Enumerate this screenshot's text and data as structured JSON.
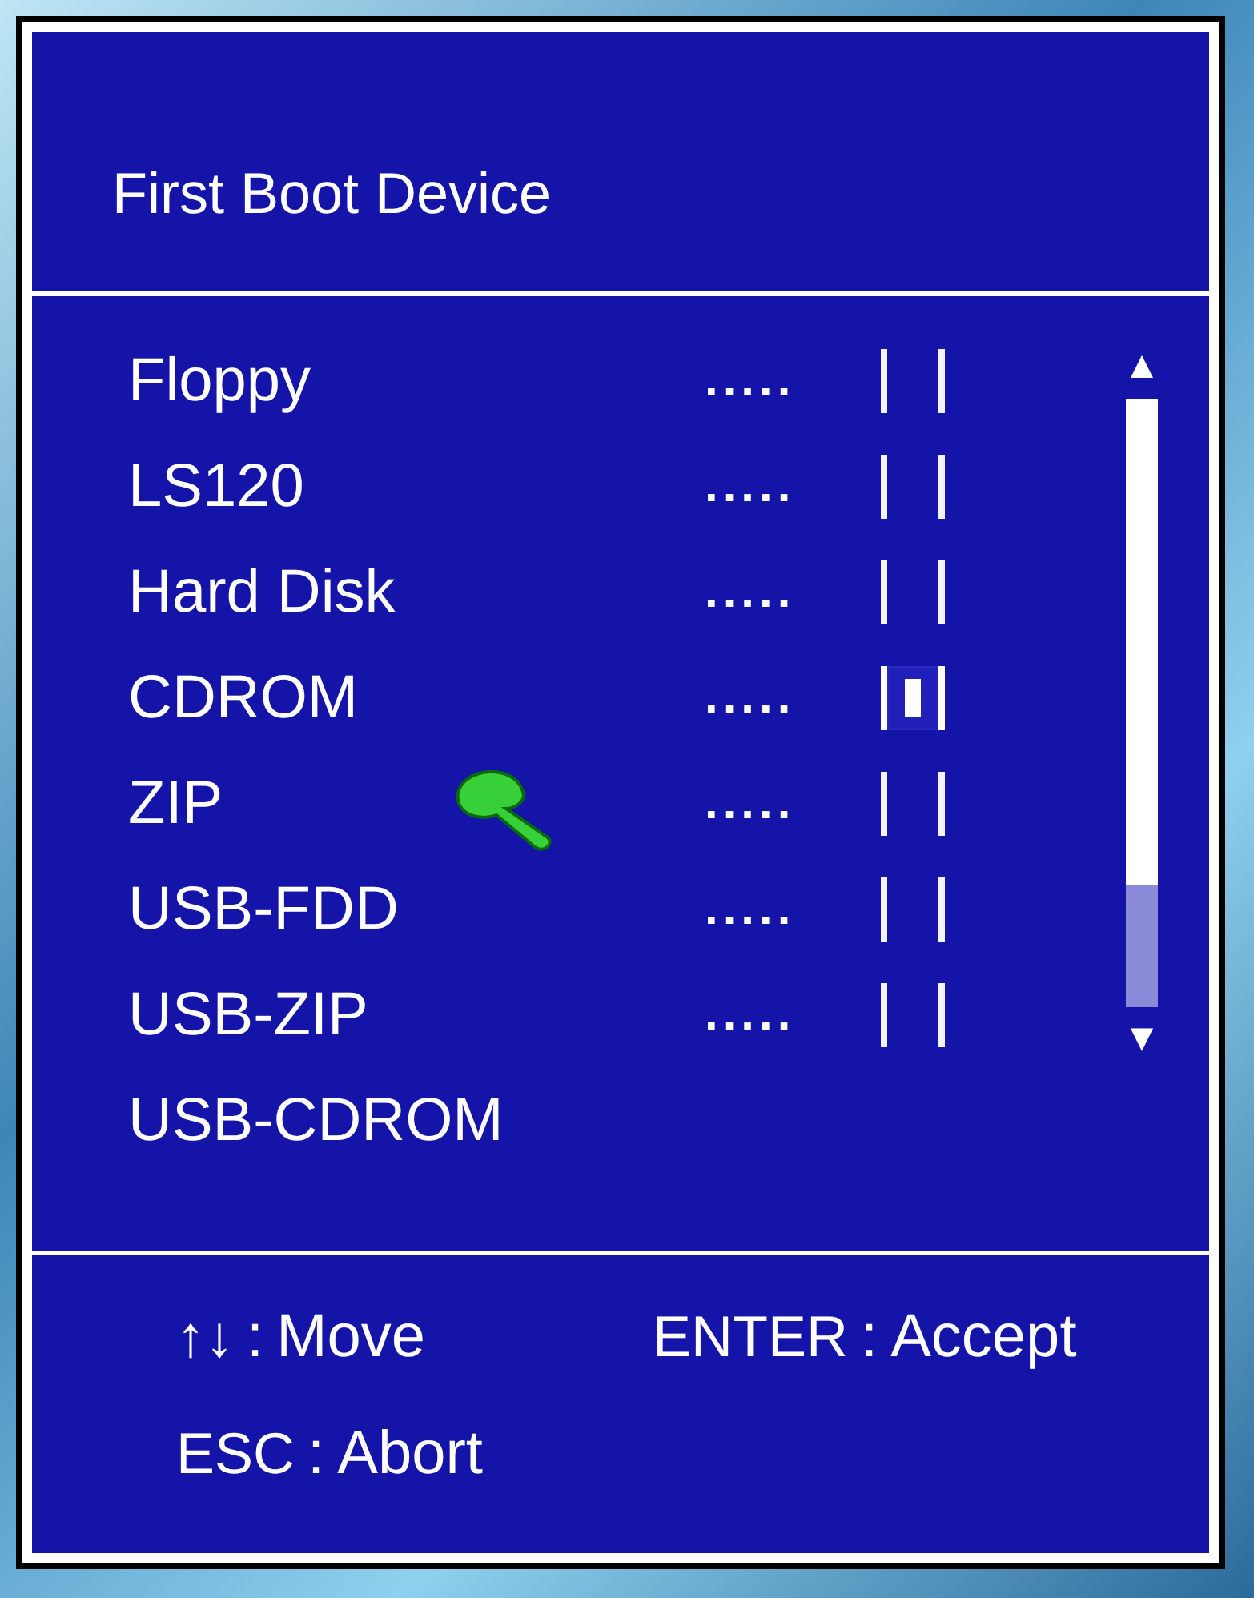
{
  "dialog": {
    "title": "First Boot Device",
    "options": [
      {
        "label": "Floppy",
        "kind": "option",
        "leader": ".....",
        "selected": false
      },
      {
        "label": "LS120",
        "kind": "option",
        "leader": ".....",
        "selected": false
      },
      {
        "label": "Hard Disk",
        "kind": "option",
        "leader": ".....",
        "selected": false
      },
      {
        "label": "CDROM",
        "kind": "option",
        "leader": ".....",
        "selected": true
      },
      {
        "label": "ZIP",
        "kind": "option",
        "leader": ".....",
        "selected": false
      },
      {
        "label": "USB-FDD",
        "kind": "option",
        "leader": ".....",
        "selected": false
      },
      {
        "label": "USB-ZIP",
        "kind": "option",
        "leader": ".....",
        "selected": false
      },
      {
        "label": "USB-CDROM",
        "kind": "plain"
      }
    ],
    "scrollbar": {
      "up": "▲",
      "down": "▼"
    },
    "hints": [
      {
        "key": "↑↓",
        "separator": ":",
        "action": "Move"
      },
      {
        "key": "ENTER",
        "separator": ":",
        "action": "Accept"
      },
      {
        "key": "ESC",
        "separator": ":",
        "action": "Abort"
      }
    ]
  }
}
